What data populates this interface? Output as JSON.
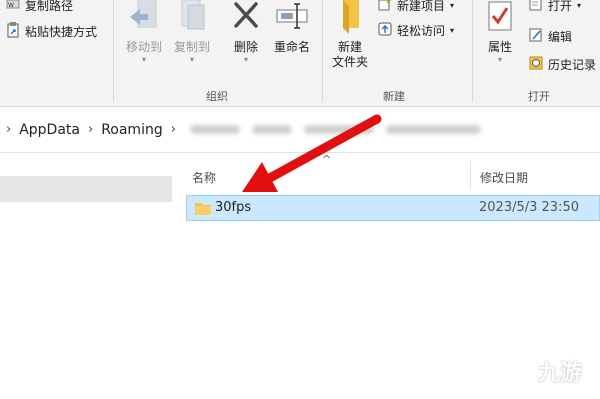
{
  "ribbon": {
    "clipboard": {
      "copy_path": "复制路径",
      "paste_shortcut": "粘贴快捷方式"
    },
    "organize": {
      "move_to": "移动到",
      "copy_to": "复制到",
      "delete": "删除",
      "rename": "重命名",
      "group_label": "组织"
    },
    "new": {
      "new_folder_line1": "新建",
      "new_folder_line2": "文件夹",
      "new_item": "新建项目",
      "easy_access": "轻松访问",
      "group_label": "新建"
    },
    "open": {
      "properties": "属性",
      "open": "打开",
      "edit": "编辑",
      "history": "历史记录",
      "group_label": "打开"
    }
  },
  "address_bar": {
    "path": [
      "AppData",
      "Roaming"
    ]
  },
  "file_list": {
    "columns": {
      "name": "名称",
      "date_modified": "修改日期"
    },
    "rows": [
      {
        "name": "30fps",
        "date": "2023/5/3 23:50",
        "selected": true
      }
    ]
  },
  "watermark": {
    "text": "九游"
  },
  "colors": {
    "selection_bg": "#cce8ff",
    "selection_border": "#99d1ff",
    "arrow": "#e01010",
    "folder": "#f5c542"
  }
}
